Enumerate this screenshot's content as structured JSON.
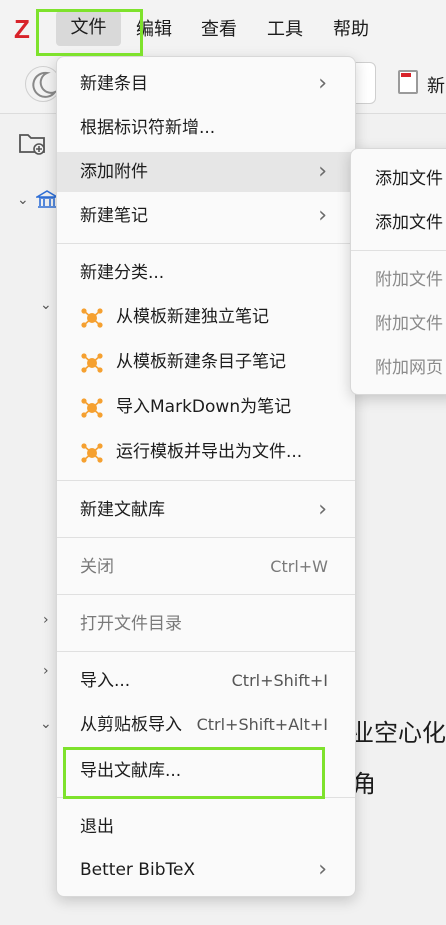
{
  "menubar": {
    "logo": "Z",
    "items": [
      "文件",
      "编辑",
      "查看",
      "工具",
      "帮助"
    ]
  },
  "toolbar": {
    "new_label": "新"
  },
  "background_text": {
    "line1": "业空心化",
    "line2": "角"
  },
  "file_menu": {
    "items": [
      {
        "label": "新建条目"
      },
      {
        "label": "根据标识符新增..."
      },
      {
        "label": "添加附件"
      },
      {
        "label": "新建笔记"
      },
      {
        "label": "新建分类..."
      },
      {
        "label": "从模板新建独立笔记",
        "icon": "template-plugin-icon"
      },
      {
        "label": "从模板新建条目子笔记",
        "icon": "template-plugin-icon"
      },
      {
        "label": "导入MarkDown为笔记",
        "icon": "template-plugin-icon"
      },
      {
        "label": "运行模板并导出为文件...",
        "icon": "template-plugin-icon"
      },
      {
        "label": "新建文献库"
      },
      {
        "label": "关闭",
        "shortcut": "Ctrl+W"
      },
      {
        "label": "打开文件目录"
      },
      {
        "label": "导入...",
        "shortcut": "Ctrl+Shift+I"
      },
      {
        "label": "从剪贴板导入",
        "shortcut": "Ctrl+Shift+Alt+I"
      },
      {
        "label": "导出文献库..."
      },
      {
        "label": "退出"
      },
      {
        "label": "Better BibTeX"
      }
    ]
  },
  "submenu": {
    "items": [
      "添加文件",
      "添加文件",
      "附加文件",
      "附加文件",
      "附加网页"
    ]
  },
  "colors": {
    "highlight": "#7ee22c",
    "logo": "#d8232a",
    "plugin_icon": "#f5a030"
  }
}
